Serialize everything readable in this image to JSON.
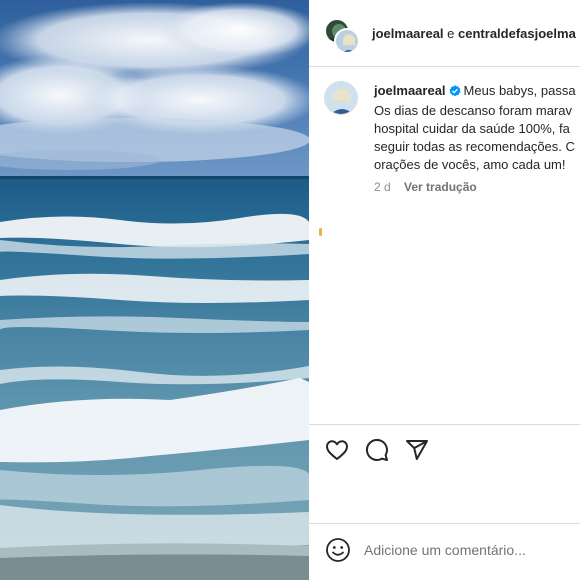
{
  "header": {
    "owner": "joelmaareal",
    "conjunction": "e",
    "collaborator": "centraldefasjoelma"
  },
  "caption": {
    "username": "joelmaareal",
    "verified": true,
    "lines": [
      "Meus babys, passa",
      "Os dias de descanso foram marav",
      "hospital cuidar da saúde 100%, fa",
      "seguir todas as recomendações. C",
      "orações de vocês, amo cada um!"
    ],
    "time": "2 d",
    "translate_label": "Ver tradução"
  },
  "actions": {
    "icons": [
      "heart-icon",
      "comment-icon",
      "share-icon"
    ]
  },
  "comment": {
    "placeholder": "Adicione um comentário...",
    "emoji_icon": "emoji-smile-icon"
  },
  "colors": {
    "text": "#262626",
    "muted": "#8e8e8e",
    "verified": "#0095f6",
    "divider": "#dbdbdb"
  }
}
